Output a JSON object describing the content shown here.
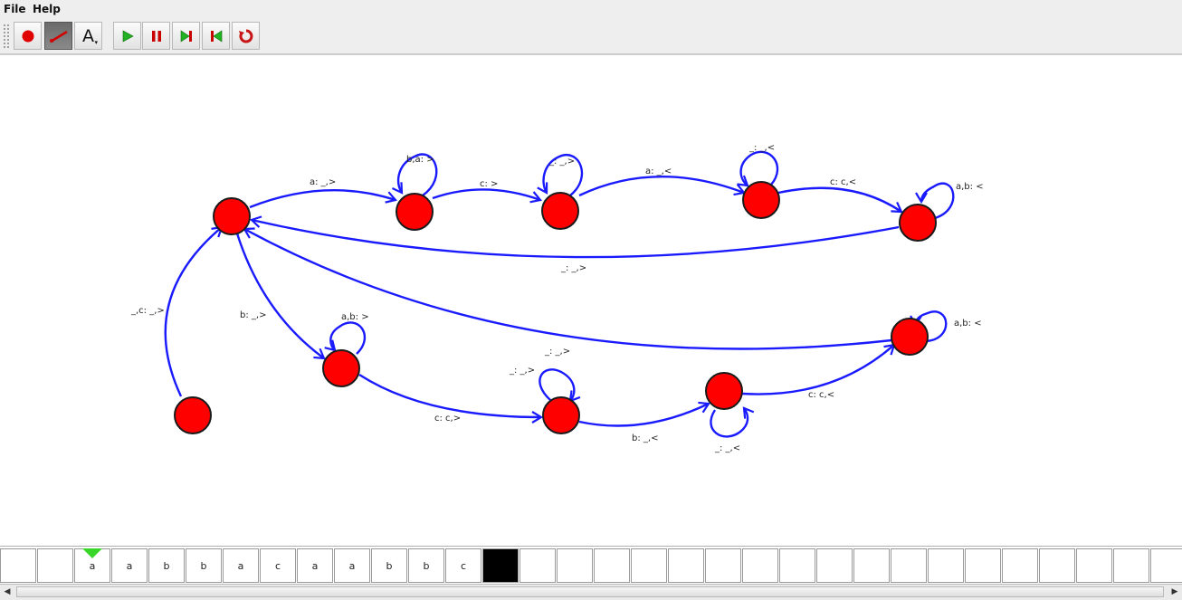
{
  "menu": {
    "file": "File",
    "help": "Help"
  },
  "toolbar": {
    "buttons": [
      {
        "name": "add-state",
        "icon": "red-circle-icon"
      },
      {
        "name": "add-transition",
        "icon": "transition-line-icon"
      },
      {
        "name": "label-tool",
        "icon": "text-label-icon",
        "label": "A"
      },
      {
        "name": "run",
        "icon": "play-icon"
      },
      {
        "name": "pause",
        "icon": "pause-icon"
      },
      {
        "name": "step-forward",
        "icon": "step-forward-icon"
      },
      {
        "name": "step-back",
        "icon": "step-back-icon"
      },
      {
        "name": "reset",
        "icon": "reset-icon"
      }
    ]
  },
  "diagram": {
    "state_color": "#ff0000",
    "edge_color": "#1a1aff",
    "transitions": [
      {
        "label": "a: _,>"
      },
      {
        "label": "b,a: >"
      },
      {
        "label": "c: >"
      },
      {
        "label": "_: _,>"
      },
      {
        "label": "a: _,<"
      },
      {
        "label": "_: _,<"
      },
      {
        "label": "c: c,<"
      },
      {
        "label": "a,b: <"
      },
      {
        "label": "_: _,>"
      },
      {
        "label": "_,c: _,>"
      },
      {
        "label": "b: _,>"
      },
      {
        "label": "a,b: >"
      },
      {
        "label": "_: _,>"
      },
      {
        "label": "_: _,>"
      },
      {
        "label": "a,b: <"
      },
      {
        "label": "c: c,>"
      },
      {
        "label": "b: _,<"
      },
      {
        "label": "_: _,<"
      },
      {
        "label": "c: c,<"
      }
    ]
  },
  "tape": {
    "head_index": 2,
    "cells": [
      "",
      "",
      "a",
      "a",
      "b",
      "b",
      "a",
      "c",
      "a",
      "a",
      "b",
      "b",
      "c",
      "",
      "",
      "",
      "",
      "",
      "",
      "",
      "",
      "",
      "",
      "",
      "",
      "",
      "",
      "",
      "",
      "",
      "",
      "",
      ""
    ],
    "blank_index": 13
  },
  "scrollbar": {
    "left": "◀",
    "right": "▶"
  }
}
